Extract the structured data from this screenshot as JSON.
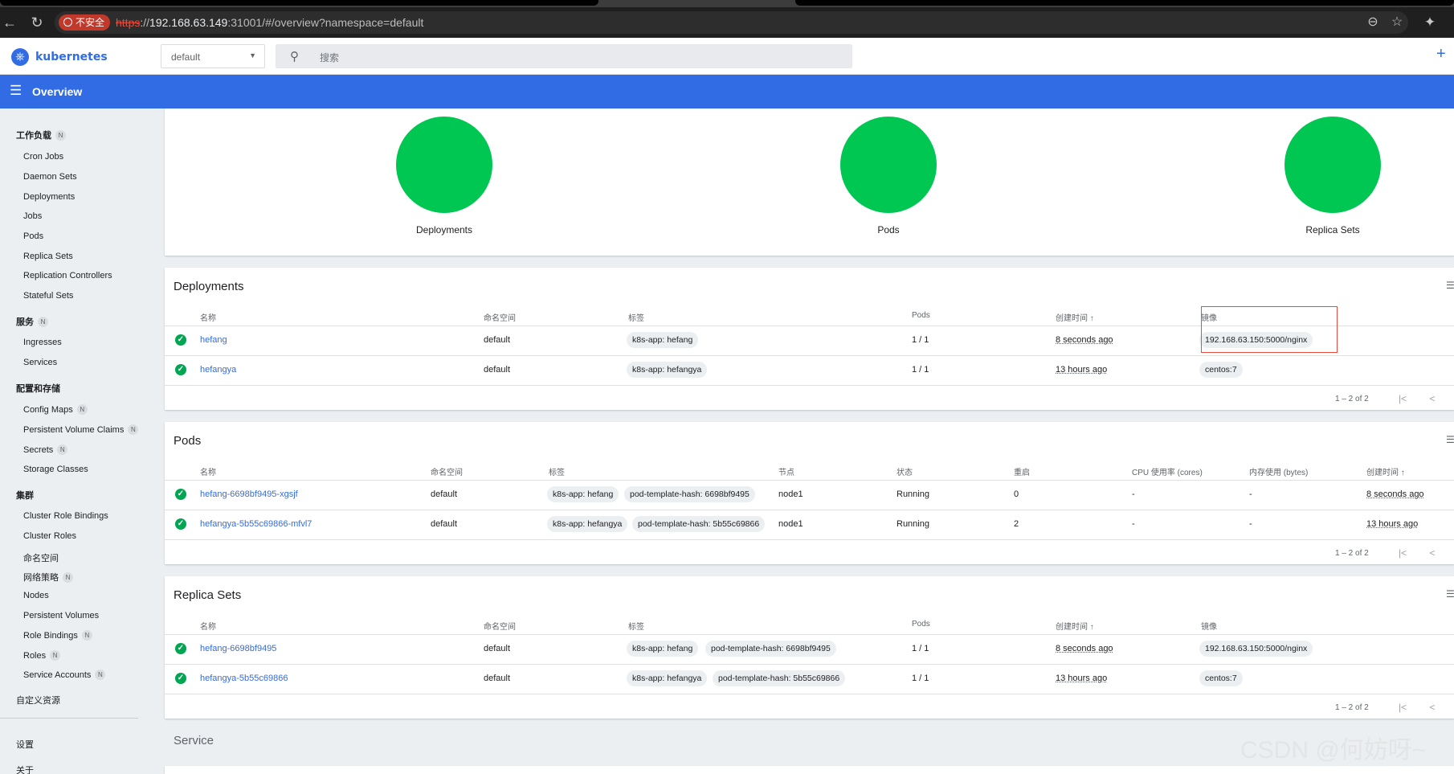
{
  "browser": {
    "security_badge": "不安全",
    "url_scheme": "https",
    "url_sep": "://",
    "url_host": "192.168.63.149",
    "url_rest": ":31001/#/overview?namespace=default"
  },
  "header": {
    "logo_text": "kubernetes",
    "namespace_value": "default",
    "search_placeholder": "搜索"
  },
  "toolbar": {
    "title": "Overview"
  },
  "sidebar": {
    "workloads_title": "工作负载",
    "workloads": [
      "Cron Jobs",
      "Daemon Sets",
      "Deployments",
      "Jobs",
      "Pods",
      "Replica Sets",
      "Replication Controllers",
      "Stateful Sets"
    ],
    "service_title": "服务",
    "service": [
      "Ingresses",
      "Services"
    ],
    "config_title": "配置和存储",
    "config": [
      "Config Maps",
      "Persistent Volume Claims",
      "Secrets",
      "Storage Classes"
    ],
    "cluster_title": "集群",
    "cluster": [
      "Cluster Role Bindings",
      "Cluster Roles",
      "命名空间",
      "网络策略",
      "Nodes",
      "Persistent Volumes",
      "Role Bindings",
      "Roles",
      "Service Accounts"
    ],
    "crd": "自定义资源",
    "settings": "设置",
    "about": "关于",
    "badge": "N"
  },
  "status_charts": [
    "Deployments",
    "Pods",
    "Replica Sets"
  ],
  "deployments": {
    "title": "Deployments",
    "headers": [
      "名称",
      "命名空间",
      "标签",
      "Pods",
      "创建时间",
      "镜像"
    ],
    "rows": [
      {
        "name": "hefang",
        "namespace": "default",
        "labels": [
          "k8s-app: hefang"
        ],
        "pods": "1 / 1",
        "created": "8 seconds ago",
        "image": "192.168.63.150:5000/nginx"
      },
      {
        "name": "hefangya",
        "namespace": "default",
        "labels": [
          "k8s-app: hefangya"
        ],
        "pods": "1 / 1",
        "created": "13 hours ago",
        "image": "centos:7"
      }
    ],
    "pager": "1 – 2 of 2"
  },
  "pods": {
    "title": "Pods",
    "headers": [
      "名称",
      "命名空间",
      "标签",
      "节点",
      "状态",
      "重启",
      "CPU 使用率 (cores)",
      "内存使用 (bytes)",
      "创建时间"
    ],
    "rows": [
      {
        "name": "hefang-6698bf9495-xgsjf",
        "namespace": "default",
        "labels": [
          "k8s-app: hefang",
          "pod-template-hash: 6698bf9495"
        ],
        "node": "node1",
        "status": "Running",
        "restarts": "0",
        "cpu": "-",
        "mem": "-",
        "created": "8 seconds ago"
      },
      {
        "name": "hefangya-5b55c69866-mfvl7",
        "namespace": "default",
        "labels": [
          "k8s-app: hefangya",
          "pod-template-hash: 5b55c69866"
        ],
        "node": "node1",
        "status": "Running",
        "restarts": "2",
        "cpu": "-",
        "mem": "-",
        "created": "13 hours ago"
      }
    ],
    "pager": "1 – 2 of 2"
  },
  "replicasets": {
    "title": "Replica Sets",
    "headers": [
      "名称",
      "命名空间",
      "标签",
      "Pods",
      "创建时间",
      "镜像"
    ],
    "rows": [
      {
        "name": "hefang-6698bf9495",
        "namespace": "default",
        "labels": [
          "k8s-app: hefang",
          "pod-template-hash: 6698bf9495"
        ],
        "pods": "1 / 1",
        "created": "8 seconds ago",
        "image": "192.168.63.150:5000/nginx"
      },
      {
        "name": "hefangya-5b55c69866",
        "namespace": "default",
        "labels": [
          "k8s-app: hefangya",
          "pod-template-hash: 5b55c69866"
        ],
        "pods": "1 / 1",
        "created": "13 hours ago",
        "image": "centos:7"
      }
    ],
    "pager": "1 – 2 of 2"
  },
  "service_section": {
    "title": "Service"
  },
  "watermark": "CSDN @何妨呀~",
  "colors": {
    "brand": "#326ce5",
    "status_ok": "#00c752",
    "highlight": "#e74c3c"
  }
}
